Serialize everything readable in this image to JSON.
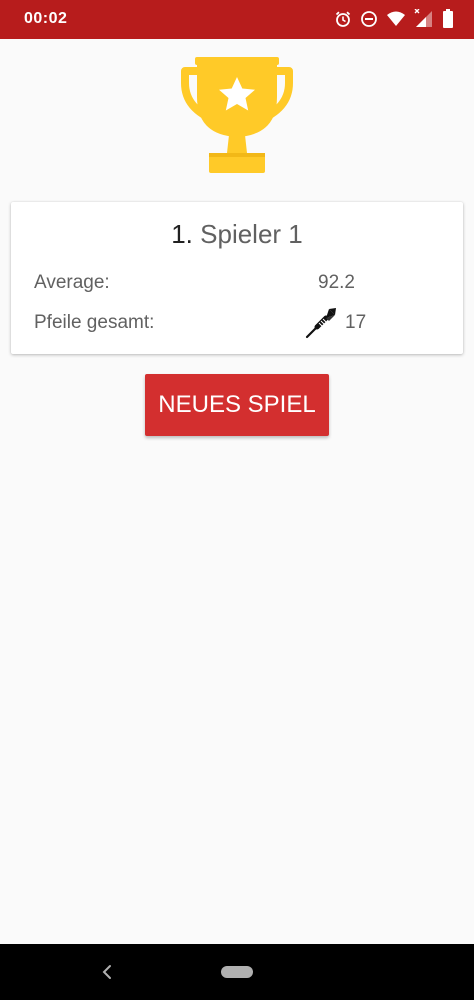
{
  "status_bar": {
    "time": "00:02",
    "icons": [
      "alarm-icon",
      "do-not-disturb-icon",
      "wifi-icon",
      "signal-icon",
      "battery-icon"
    ],
    "background_color": "#b71c1c"
  },
  "trophy": {
    "icon": "trophy-icon",
    "color": "#ffca28"
  },
  "result_card": {
    "rank": "1.",
    "player_name": "Spieler 1",
    "average_label": "Average:",
    "average_value": "92.2",
    "darts_label": "Pfeile gesamt:",
    "darts_icon": "dart-icon",
    "darts_value": "17"
  },
  "actions": {
    "new_game_label": "NEUES SPIEL",
    "button_color": "#d32f2f"
  },
  "nav_bar": {
    "icons": [
      "back-icon",
      "home-pill-icon"
    ]
  }
}
